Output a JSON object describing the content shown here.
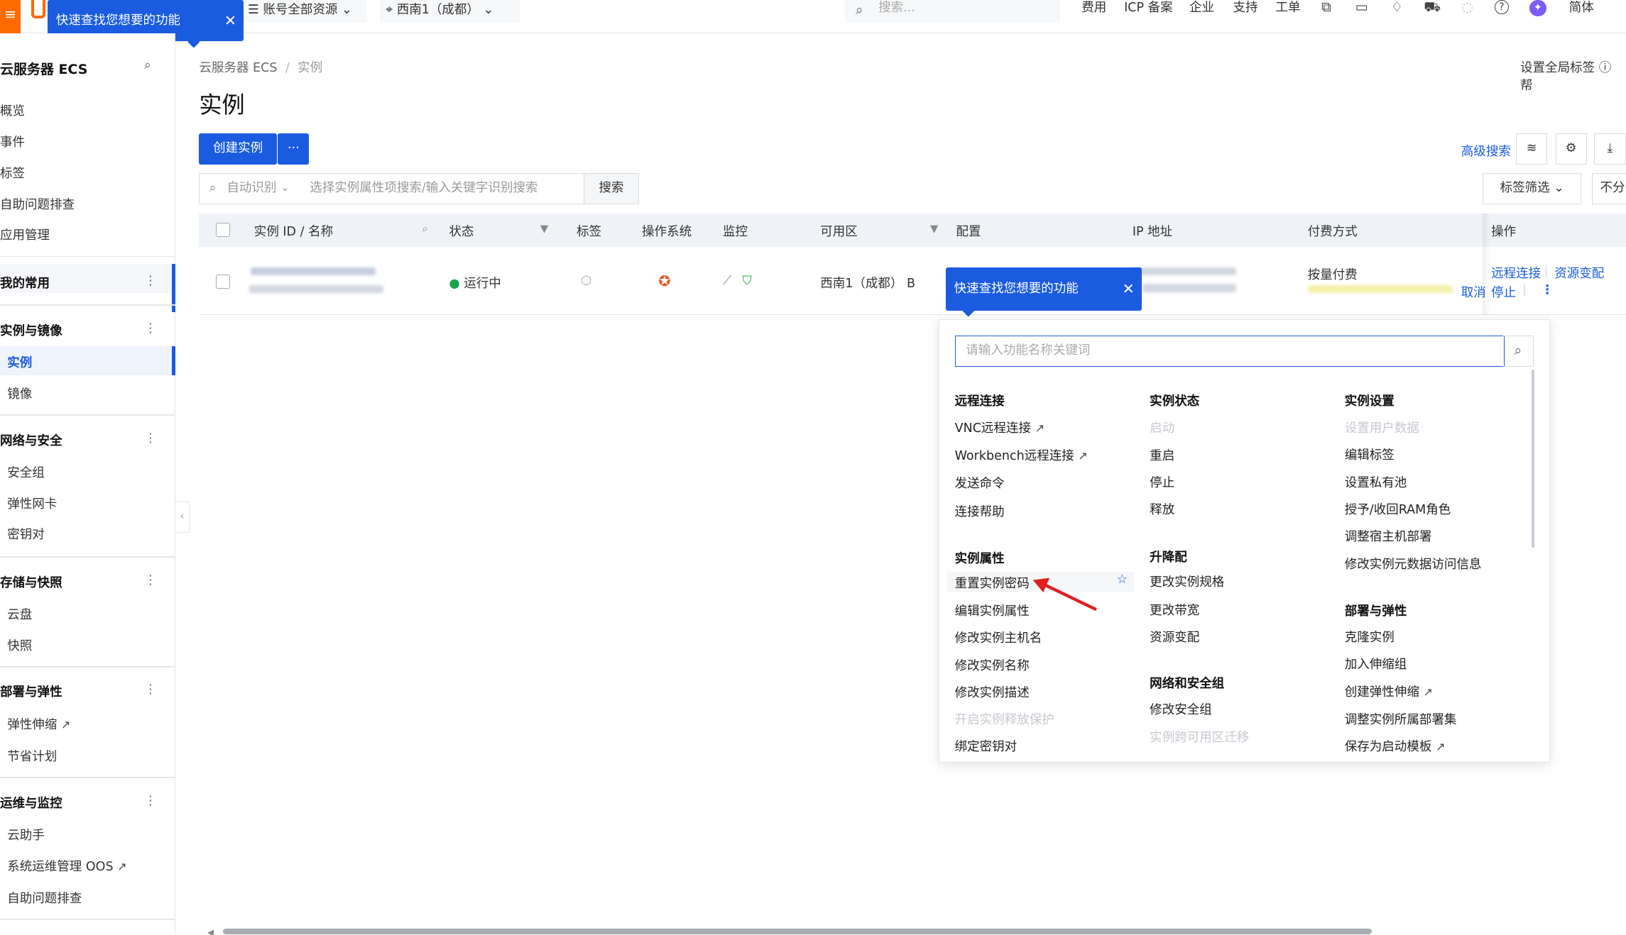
{
  "topbar": {
    "logo_glyph": "≡",
    "account_selector": "账号全部资源",
    "region_selector": "西南1（成都）",
    "search_placeholder": "搜索...",
    "nav": [
      "费用",
      "ICP 备案",
      "企业",
      "支持",
      "工单"
    ],
    "lang": "简体",
    "icons": [
      "ai-assistant-icon",
      "terminal-icon",
      "bell-icon",
      "cart-icon",
      "lightbulb-icon",
      "help-icon",
      "avatar-icon"
    ]
  },
  "tooltip_top": "快速查找您想要的功能",
  "sidebar": {
    "title": "云服务器 ECS",
    "top_items": [
      "概览",
      "事件",
      "标签",
      "自助问题排查",
      "应用管理"
    ],
    "groups": [
      {
        "label": "我的常用",
        "items": []
      },
      {
        "label": "实例与镜像",
        "items": [
          "实例",
          "镜像"
        ]
      },
      {
        "label": "网络与安全",
        "items": [
          "安全组",
          "弹性网卡",
          "密钥对"
        ]
      },
      {
        "label": "存储与快照",
        "items": [
          "云盘",
          "快照"
        ]
      },
      {
        "label": "部署与弹性",
        "items": [
          "弹性伸缩",
          "节省计划"
        ]
      },
      {
        "label": "运维与监控",
        "items": [
          "云助手",
          "系统运维管理 OOS",
          "自助问题排查"
        ]
      }
    ],
    "active_item": "实例"
  },
  "main": {
    "breadcrumb": [
      "云服务器 ECS",
      "/",
      "实例"
    ],
    "global_tag": "设置全局标签",
    "help": "帮",
    "title": "实例",
    "create_button": "创建实例",
    "more_button": "···",
    "advanced_search": "高级搜索",
    "search_mode": "自动识别",
    "search_placeholder": "选择实例属性项搜索/输入关键字识别搜索",
    "search_button": "搜索",
    "tag_filter": "标签筛选",
    "no_group": "不分"
  },
  "table": {
    "columns": [
      "实例 ID / 名称",
      "状态",
      "标签",
      "操作系统",
      "监控",
      "可用区",
      "配置",
      "IP 地址",
      "付费方式",
      "操作"
    ],
    "row": {
      "status": "运行中",
      "zone": "西南1（成都） B",
      "billing": "按量付费",
      "cancel": "取消",
      "actions": [
        "远程连接",
        "资源变配",
        "停止"
      ]
    }
  },
  "tooltip_row": "快速查找您想要的功能",
  "popup": {
    "search_placeholder": "请输入功能名称关键词",
    "col1": {
      "sec1": {
        "title": "远程连接",
        "items": [
          "VNC远程连接",
          "Workbench远程连接",
          "发送命令",
          "连接帮助"
        ]
      },
      "sec2": {
        "title": "实例属性",
        "items": [
          "重置实例密码",
          "编辑实例属性",
          "修改实例主机名",
          "修改实例名称",
          "修改实例描述",
          "开启实例释放保护",
          "绑定密钥对"
        ]
      }
    },
    "col2": {
      "sec1": {
        "title": "实例状态",
        "items": [
          "启动",
          "重启",
          "停止",
          "释放"
        ]
      },
      "sec2": {
        "title": "升降配",
        "items": [
          "更改实例规格",
          "更改带宽",
          "资源变配"
        ]
      },
      "sec3": {
        "title": "网络和安全组",
        "items": [
          "修改安全组",
          "实例跨可用区迁移"
        ]
      }
    },
    "col3": {
      "sec1": {
        "title": "实例设置",
        "items": [
          "设置用户数据",
          "编辑标签",
          "设置私有池",
          "授予/收回RAM角色",
          "调整宿主机部署",
          "修改实例元数据访问信息"
        ]
      },
      "sec2": {
        "title": "部署与弹性",
        "items": [
          "克隆实例",
          "加入伸缩组",
          "创建弹性伸缩",
          "调整实例所属部署集",
          "保存为启动模板"
        ]
      }
    }
  },
  "colors": {
    "primary": "#1a5be0",
    "brand": "#ff6a00",
    "success": "#1aa34a",
    "annotation_arrow": "#e02020"
  }
}
